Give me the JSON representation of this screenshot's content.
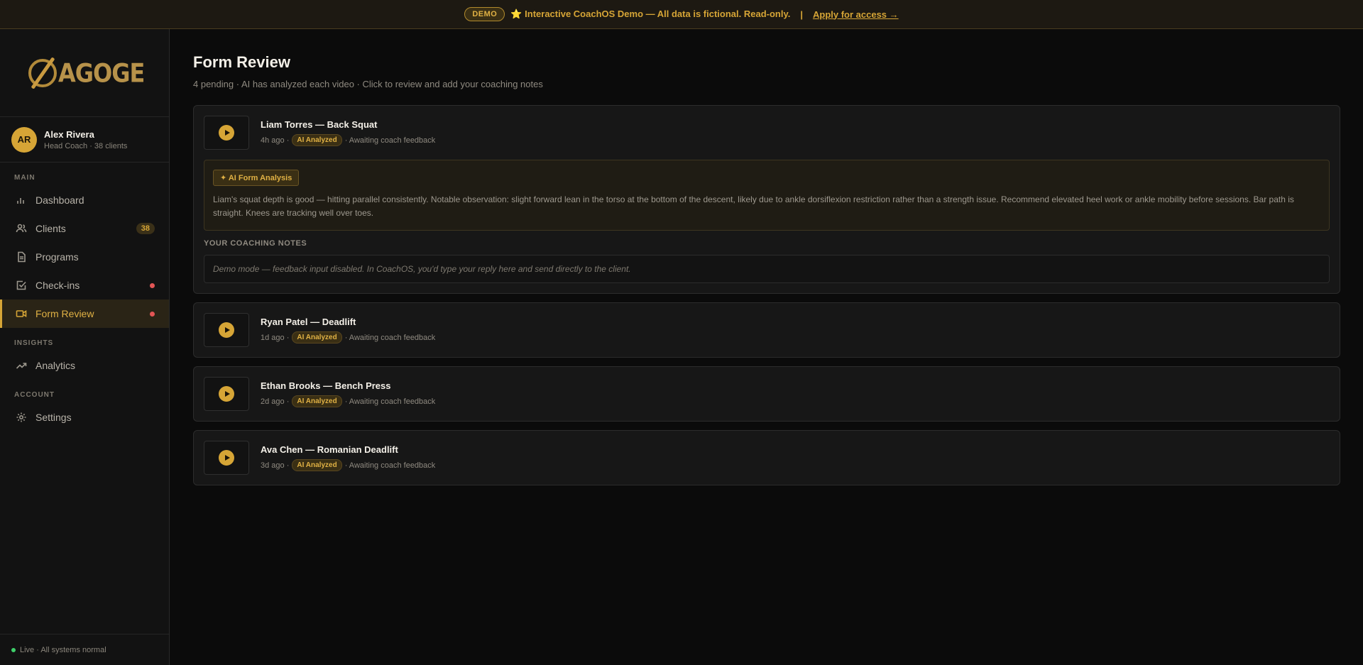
{
  "banner": {
    "pill": "DEMO",
    "message": "⭐ Interactive CoachOS Demo — All data is fictional. Read-only.",
    "separator": "|",
    "apply": "Apply for access →"
  },
  "logo": {
    "text": "AGOGE"
  },
  "profile": {
    "initials": "AR",
    "name": "Alex Rivera",
    "role": "Head Coach · 38 clients"
  },
  "nav": {
    "main_label": "MAIN",
    "insights_label": "INSIGHTS",
    "account_label": "ACCOUNT",
    "items": {
      "dashboard": "Dashboard",
      "clients": "Clients",
      "clients_count": "38",
      "programs": "Programs",
      "checkins": "Check-ins",
      "form_review": "Form Review",
      "analytics": "Analytics",
      "settings": "Settings"
    }
  },
  "footer": {
    "status": "Live · All systems normal"
  },
  "page": {
    "title": "Form Review",
    "subtitle": "4 pending · AI has analyzed each video · Click to review and add your coaching notes"
  },
  "reviews": [
    {
      "title": "Liam Torres — Back Squat",
      "time": "4h ago ·",
      "badge": "AI Analyzed",
      "status": "· Awaiting coach feedback",
      "analysis_tag": "✦ AI Form Analysis",
      "analysis": "Liam's squat depth is good — hitting parallel consistently. Notable observation: slight forward lean in the torso at the bottom of the descent, likely due to ankle dorsiflexion restriction rather than a strength issue. Recommend elevated heel work or ankle mobility before sessions. Bar path is straight. Knees are tracking well over toes.",
      "notes_label": "YOUR COACHING NOTES",
      "notes_placeholder": "Demo mode — feedback input disabled. In CoachOS, you'd type your reply here and send directly to the client."
    },
    {
      "title": "Ryan Patel — Deadlift",
      "time": "1d ago ·",
      "badge": "AI Analyzed",
      "status": "· Awaiting coach feedback"
    },
    {
      "title": "Ethan Brooks — Bench Press",
      "time": "2d ago ·",
      "badge": "AI Analyzed",
      "status": "· Awaiting coach feedback"
    },
    {
      "title": "Ava Chen — Romanian Deadlift",
      "time": "3d ago ·",
      "badge": "AI Analyzed",
      "status": "· Awaiting coach feedback"
    }
  ],
  "colors": {
    "accent": "#d6a536",
    "background": "#0b0b0b",
    "alert_dot": "#e25555",
    "live_dot": "#3ecf6a"
  }
}
